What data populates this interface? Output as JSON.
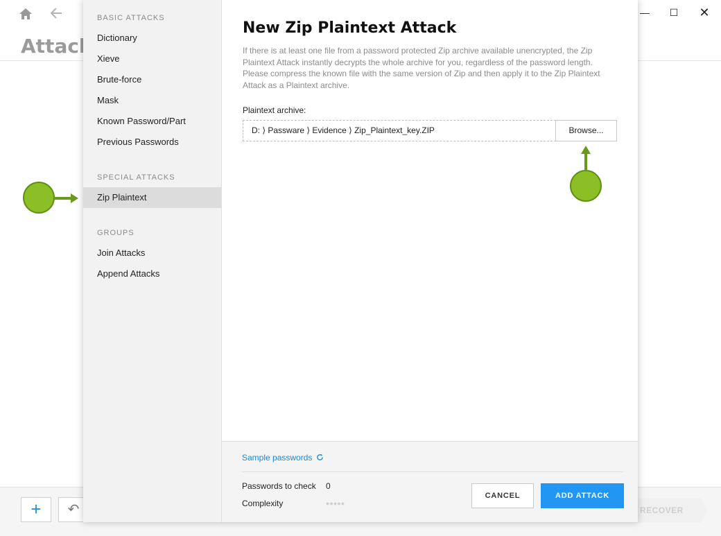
{
  "app": {
    "title": "Attack",
    "window_controls": {
      "minimize": "—",
      "maximize": "☐",
      "close": "✕"
    },
    "footer": {
      "plus_label": "+",
      "undo_label": "↶",
      "recover_label": "RECOVER"
    }
  },
  "dialog": {
    "sidebar": {
      "sections": [
        {
          "title": "BASIC ATTACKS",
          "items": [
            "Dictionary",
            "Xieve",
            "Brute-force",
            "Mask",
            "Known Password/Part",
            "Previous Passwords"
          ]
        },
        {
          "title": "SPECIAL ATTACKS",
          "items": [
            "Zip Plaintext"
          ]
        },
        {
          "title": "GROUPS",
          "items": [
            "Join Attacks",
            "Append Attacks"
          ]
        }
      ],
      "active_item": "Zip Plaintext"
    },
    "heading": "New Zip Plaintext Attack",
    "description": "If there is at least one file from a password protected Zip archive available unencrypted, the Zip Plaintext Attack instantly decrypts the whole archive for you, regardless of the password length. Please compress the known file with the same version of Zip and then apply it to the Zip Plaintext Attack as a Plaintext archive.",
    "field_label": "Plaintext archive:",
    "path_value": "D:  ⟩ Passware  ⟩ Evidence  ⟩ Zip_Plaintext_key.ZIP",
    "browse_label": "Browse...",
    "footer": {
      "sample_link": "Sample passwords",
      "passwords_to_check_label": "Passwords to check",
      "passwords_to_check_value": "0",
      "complexity_label": "Complexity",
      "complexity_dots": "●●●●●",
      "cancel_label": "CANCEL",
      "add_label": "ADD ATTACK"
    }
  },
  "colors": {
    "accent": "#2196f3",
    "link": "#1e86d6",
    "marker": "#8cbf26",
    "marker_border": "#5f8f14"
  }
}
